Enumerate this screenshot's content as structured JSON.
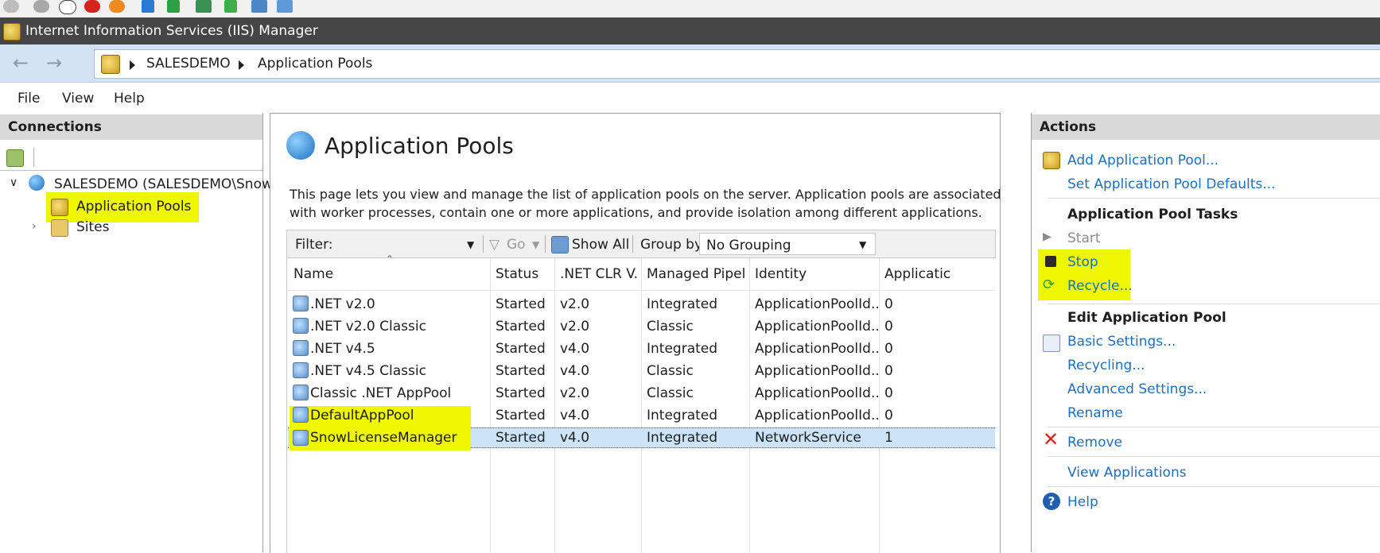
{
  "title_bar": {
    "title": "Internet Information Services (IIS) Manager"
  },
  "address_bar": {
    "crumbs": [
      "SALESDEMO",
      "Application Pools"
    ]
  },
  "menu": {
    "items": [
      "File",
      "View",
      "Help"
    ]
  },
  "connections": {
    "header": "Connections",
    "tree": {
      "server": "SALESDEMO (SALESDEMO\\Snow",
      "app_pools": "Application Pools",
      "sites": "Sites"
    }
  },
  "main": {
    "title": "Application Pools",
    "description_line1": "This page lets you view and manage the list of application pools on the server. Application pools are associated",
    "description_line2": "with worker processes, contain one or more applications, and provide isolation among different applications.",
    "filter": {
      "label": "Filter:",
      "value": "",
      "go": "Go",
      "show_all": "Show All",
      "group_by_label": "Group by:",
      "group_by_value": "No Grouping"
    },
    "columns": [
      "Name",
      "Status",
      ".NET CLR V...",
      "Managed Pipel...",
      "Identity",
      "Applicatic"
    ],
    "rows": [
      {
        "name": ".NET v2.0",
        "status": "Started",
        "clr": "v2.0",
        "pipeline": "Integrated",
        "identity": "ApplicationPoolId...",
        "apps": "0"
      },
      {
        "name": ".NET v2.0 Classic",
        "status": "Started",
        "clr": "v2.0",
        "pipeline": "Classic",
        "identity": "ApplicationPoolId...",
        "apps": "0"
      },
      {
        "name": ".NET v4.5",
        "status": "Started",
        "clr": "v4.0",
        "pipeline": "Integrated",
        "identity": "ApplicationPoolId...",
        "apps": "0"
      },
      {
        "name": ".NET v4.5 Classic",
        "status": "Started",
        "clr": "v4.0",
        "pipeline": "Classic",
        "identity": "ApplicationPoolId...",
        "apps": "0"
      },
      {
        "name": "Classic .NET AppPool",
        "status": "Started",
        "clr": "v2.0",
        "pipeline": "Classic",
        "identity": "ApplicationPoolId...",
        "apps": "0"
      },
      {
        "name": "DefaultAppPool",
        "status": "Started",
        "clr": "v4.0",
        "pipeline": "Integrated",
        "identity": "ApplicationPoolId...",
        "apps": "0"
      },
      {
        "name": "SnowLicenseManager",
        "status": "Started",
        "clr": "v4.0",
        "pipeline": "Integrated",
        "identity": "NetworkService",
        "apps": "1"
      }
    ]
  },
  "actions": {
    "header": "Actions",
    "add_pool": "Add Application Pool...",
    "set_defaults": "Set Application Pool Defaults...",
    "tasks_header": "Application Pool Tasks",
    "start": "Start",
    "stop": "Stop",
    "recycle": "Recycle...",
    "edit_header": "Edit Application Pool",
    "basic_settings": "Basic Settings...",
    "recycling": "Recycling...",
    "advanced_settings": "Advanced Settings...",
    "rename": "Rename",
    "remove": "Remove",
    "view_apps": "View Applications",
    "help": "Help"
  },
  "colors": {
    "highlight": "#eef700",
    "link": "#1f6fbf",
    "selection": "#cce4f7",
    "titlebar": "#454545"
  }
}
